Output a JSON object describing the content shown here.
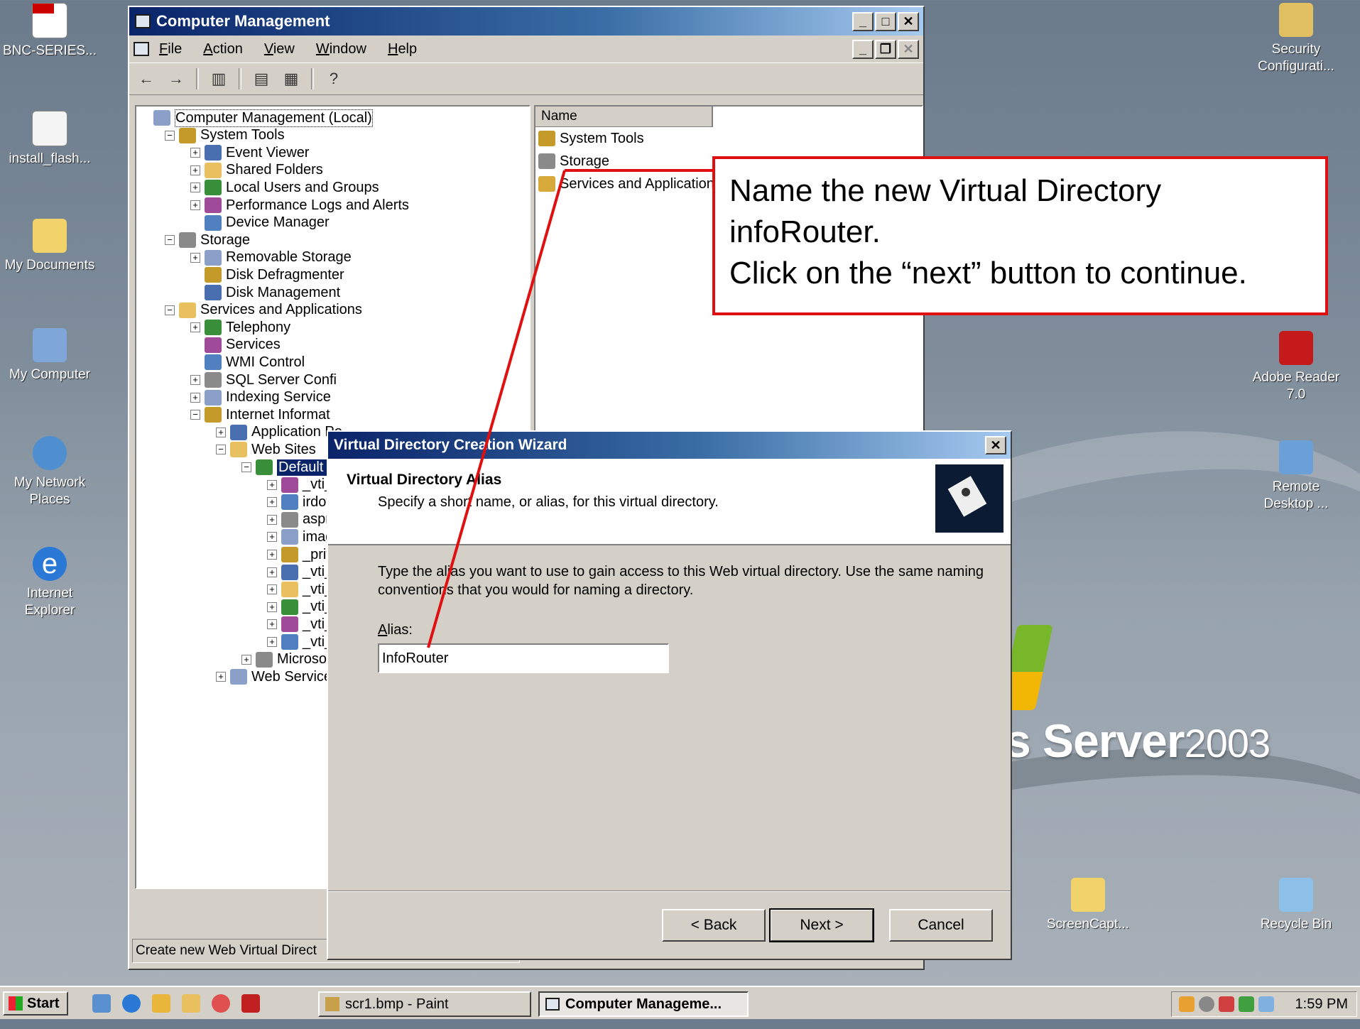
{
  "desktop": {
    "icons_left": [
      {
        "label": "BNC-SERIES..."
      },
      {
        "label": "install_flash..."
      },
      {
        "label": "My Documents"
      },
      {
        "label": "My Computer"
      },
      {
        "label": "My Network Places"
      },
      {
        "label": "Internet Explorer"
      }
    ],
    "icons_right": [
      {
        "label": "Security Configurati..."
      },
      {
        "label": "Adobe Reader 7.0"
      },
      {
        "label": "Remote Desktop ..."
      },
      {
        "label": "ScreenCapt..."
      },
      {
        "label": "Recycle Bin"
      }
    ],
    "brand_text": "s Server",
    "brand_year": "2003"
  },
  "window": {
    "title": "Computer Management",
    "menu": [
      "File",
      "Action",
      "View",
      "Window",
      "Help"
    ],
    "tree": [
      {
        "label": "Computer Management (Local)",
        "level": 0,
        "exp": ""
      },
      {
        "label": "System Tools",
        "level": 1,
        "exp": "-"
      },
      {
        "label": "Event Viewer",
        "level": 2,
        "exp": "+"
      },
      {
        "label": "Shared Folders",
        "level": 2,
        "exp": "+"
      },
      {
        "label": "Local Users and Groups",
        "level": 2,
        "exp": "+"
      },
      {
        "label": "Performance Logs and Alerts",
        "level": 2,
        "exp": "+"
      },
      {
        "label": "Device Manager",
        "level": 2,
        "exp": ""
      },
      {
        "label": "Storage",
        "level": 1,
        "exp": "-"
      },
      {
        "label": "Removable Storage",
        "level": 2,
        "exp": "+"
      },
      {
        "label": "Disk Defragmenter",
        "level": 2,
        "exp": ""
      },
      {
        "label": "Disk Management",
        "level": 2,
        "exp": ""
      },
      {
        "label": "Services and Applications",
        "level": 1,
        "exp": "-"
      },
      {
        "label": "Telephony",
        "level": 2,
        "exp": "+"
      },
      {
        "label": "Services",
        "level": 2,
        "exp": ""
      },
      {
        "label": "WMI Control",
        "level": 2,
        "exp": ""
      },
      {
        "label": "SQL Server Confi",
        "level": 2,
        "exp": "+"
      },
      {
        "label": "Indexing Service",
        "level": 2,
        "exp": "+"
      },
      {
        "label": "Internet Informat",
        "level": 2,
        "exp": "-"
      },
      {
        "label": "Application Po",
        "level": 3,
        "exp": "+"
      },
      {
        "label": "Web Sites",
        "level": 3,
        "exp": "-"
      },
      {
        "label": "Default W",
        "level": 4,
        "exp": "-",
        "selected": true
      },
      {
        "label": "_vti_l",
        "level": 5,
        "exp": "+"
      },
      {
        "label": "irdotr",
        "level": 5,
        "exp": "+"
      },
      {
        "label": "aspne",
        "level": 5,
        "exp": "+"
      },
      {
        "label": "image",
        "level": 5,
        "exp": "+"
      },
      {
        "label": "_priv",
        "level": 5,
        "exp": "+"
      },
      {
        "label": "_vti_",
        "level": 5,
        "exp": "+"
      },
      {
        "label": "_vti_l",
        "level": 5,
        "exp": "+"
      },
      {
        "label": "_vti_",
        "level": 5,
        "exp": "+"
      },
      {
        "label": "_vti_",
        "level": 5,
        "exp": "+"
      },
      {
        "label": "_vti_l",
        "level": 5,
        "exp": "+"
      },
      {
        "label": "Microsoft",
        "level": 4,
        "exp": "+"
      },
      {
        "label": "Web Service",
        "level": 3,
        "exp": "+"
      }
    ],
    "list_header": "Name",
    "list_items": [
      "System Tools",
      "Storage",
      "Services and Application"
    ],
    "status": "Create new Web Virtual Direct"
  },
  "wizard": {
    "title": "Virtual Directory Creation Wizard",
    "heading": "Virtual Directory Alias",
    "subheading": "Specify a short name, or alias, for this virtual directory.",
    "body": "Type the alias you want to use to gain access to this Web virtual directory. Use the same naming conventions that you would for naming a directory.",
    "alias_label": "Alias:",
    "alias_value": "InfoRouter",
    "back": "< Back",
    "next": "Next >",
    "cancel": "Cancel"
  },
  "callout": {
    "line1": "Name the new Virtual Directory",
    "line2": "infoRouter.",
    "line3": "Click on the “next” button to continue."
  },
  "taskbar": {
    "start": "Start",
    "tasks": [
      "scr1.bmp - Paint",
      "Computer Manageme..."
    ],
    "clock": "1:59 PM"
  },
  "colors": {
    "callout_border": "#e01010",
    "title_active": "#0a246a",
    "selection": "#0a246a"
  }
}
